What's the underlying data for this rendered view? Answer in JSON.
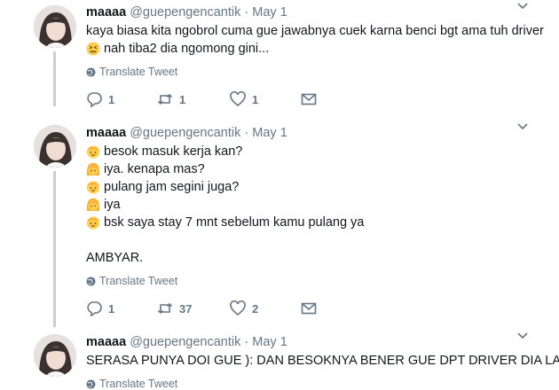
{
  "tweets": [
    {
      "name": "maaaa",
      "handle": "@guepengencantik",
      "dot": "·",
      "date": "May 1",
      "lines": [
        {
          "emoji": "",
          "text": "kaya biasa kita ngobrol cuma gue jawabnya cuek karna benci bgt ama tuh driver"
        },
        {
          "emoji": "confounded-face",
          "text": "nah tiba2 dia ngomong gini..."
        }
      ],
      "translate_label": "Translate Tweet",
      "reply_count": "1",
      "retweet_count": "1",
      "like_count": "1"
    },
    {
      "name": "maaaa",
      "handle": "@guepengencantik",
      "dot": "·",
      "date": "May 1",
      "lines": [
        {
          "emoji": "man-face",
          "text": "besok masuk kerja kan?"
        },
        {
          "emoji": "woman-face",
          "text": "iya. kenapa mas?"
        },
        {
          "emoji": "man-face",
          "text": "pulang jam segini juga?"
        },
        {
          "emoji": "woman-face",
          "text": "iya"
        },
        {
          "emoji": "man-face",
          "text": "bsk saya stay 7 mnt sebelum kamu pulang ya"
        },
        {
          "emoji": "",
          "text": ""
        },
        {
          "emoji": "",
          "text": "AMBYAR."
        }
      ],
      "translate_label": "Translate Tweet",
      "reply_count": "1",
      "retweet_count": "37",
      "like_count": "2"
    },
    {
      "name": "maaaa",
      "handle": "@guepengencantik",
      "dot": "·",
      "date": "May 1",
      "lines": [
        {
          "emoji": "",
          "text": "SERASA PUNYA DOI GUE ): DAN BESOKNYA BENER GUE DPT DRIVER DIA LAGI."
        }
      ],
      "translate_label": "Translate Tweet"
    }
  ],
  "colors": {
    "text": "#14171a",
    "secondary": "#657786",
    "thread_line": "#c4cfd6",
    "emoji_yellow": "#ffcc4d"
  }
}
